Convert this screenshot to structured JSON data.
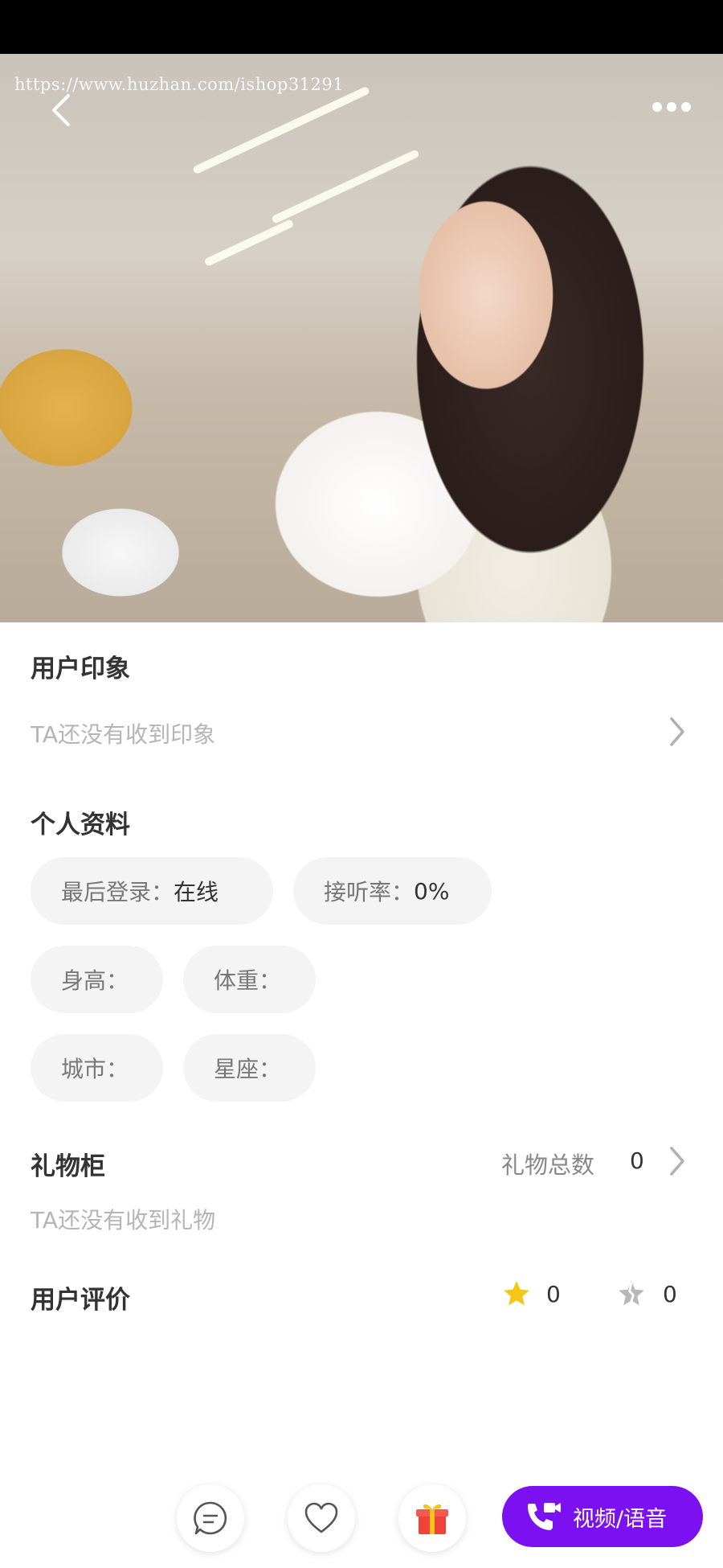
{
  "status_bar": {},
  "hero": {
    "watermark": "https://www.huzhan.com/ishop31291"
  },
  "impression": {
    "title": "用户印象",
    "empty_text": "TA还没有收到印象"
  },
  "profile": {
    "title": "个人资料",
    "last_login_label": "最后登录：",
    "last_login_value": "在线",
    "answer_rate_label": "接听率：",
    "answer_rate_value": "0%",
    "height_label": "身高：",
    "weight_label": "体重：",
    "city_label": "城市：",
    "zodiac_label": "星座："
  },
  "gifts": {
    "title": "礼物柜",
    "total_label": "礼物总数",
    "total_value": "0",
    "empty_text": "TA还没有收到礼物"
  },
  "reviews": {
    "title": "用户评价",
    "good_count": "0",
    "bad_count": "0"
  },
  "bottom_bar": {
    "call_label": "视频/语音"
  },
  "colors": {
    "accent": "#7b10f0",
    "star": "#f5c518",
    "gift": "#f0413a"
  }
}
